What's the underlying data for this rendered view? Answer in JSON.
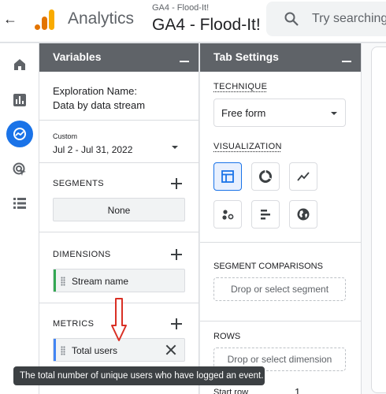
{
  "header": {
    "back_label": "←",
    "app_name": "Analytics",
    "account_small": "GA4 - Flood-It!",
    "account_big": "GA4 - Flood-It!",
    "search_placeholder": "Try searching",
    "brand_colors": [
      "#f9ab00",
      "#e37400"
    ]
  },
  "left_nav": {
    "items": [
      {
        "icon": "home-icon"
      },
      {
        "icon": "reports-icon"
      },
      {
        "icon": "explore-icon",
        "active": true
      },
      {
        "icon": "advertising-icon"
      },
      {
        "icon": "configure-icon"
      }
    ],
    "active_color": "#1a73e8"
  },
  "variables": {
    "title": "Variables",
    "exploration_label": "Exploration Name:",
    "exploration_value": "Data by data stream",
    "date_custom_label": "Custom",
    "date_range": "Jul 2 - Jul 31, 2022",
    "segments_label": "SEGMENTS",
    "segments_chip": "None",
    "dimensions_label": "DIMENSIONS",
    "dimension_chip": "Stream name",
    "dimension_color": "#34a853",
    "metrics_label": "METRICS",
    "metric_chip": "Total users",
    "metric_color": "#4285f4"
  },
  "tab_settings": {
    "title": "Tab Settings",
    "technique_label": "TECHNIQUE",
    "technique_value": "Free form",
    "visualization_label": "VISUALIZATION",
    "visualizations": [
      "table-icon",
      "donut-chart-icon",
      "line-chart-icon",
      "scatter-icon",
      "bar-chart-icon",
      "geo-map-icon"
    ],
    "segment_comparisons_label": "SEGMENT COMPARISONS",
    "segment_drop": "Drop or select segment",
    "rows_label": "ROWS",
    "rows_drop": "Drop or select dimension",
    "start_row_label": "Start row",
    "start_row_value": "1"
  },
  "tooltip": {
    "text": "The total number of unique users who have logged an event."
  },
  "annotation": {
    "arrow_color": "#d93025"
  }
}
